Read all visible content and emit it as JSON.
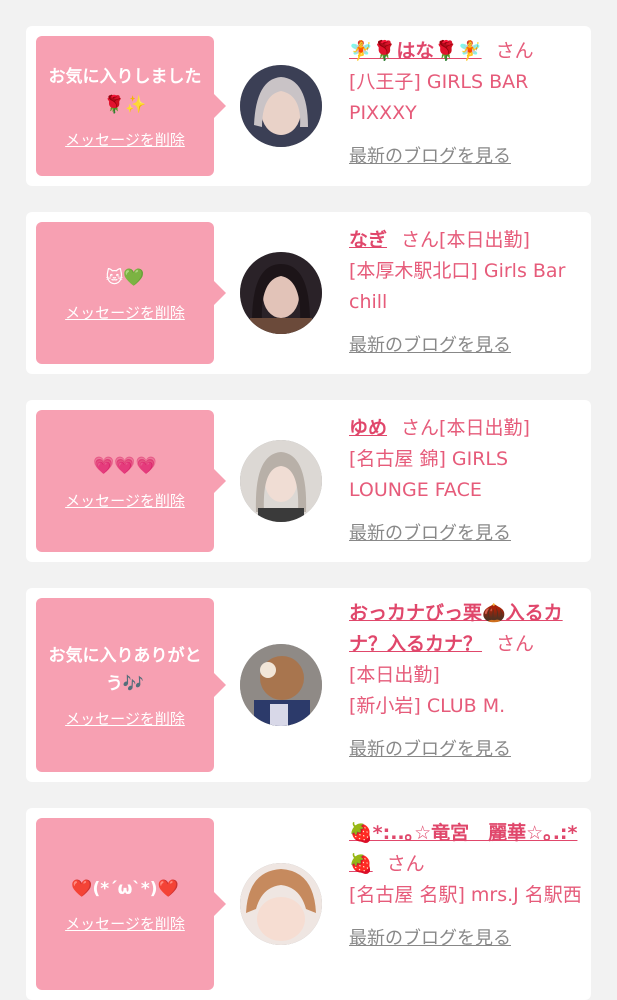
{
  "favorites": [
    {
      "message": "お気に入りしました🌹✨",
      "delete_label": "メッセージを削除",
      "name": "🧚🌹はな🌹🧚",
      "suffix": "さん",
      "status": "",
      "shop": "[八王子] GIRLS BAR PIXXXY",
      "blog_link": "最新のブログを見る"
    },
    {
      "message": "🐱💚",
      "delete_label": "メッセージを削除",
      "name": "なぎ",
      "suffix": "さん",
      "status": "[本日出勤]",
      "shop": "[本厚木駅北口] Girls Bar chill",
      "blog_link": "最新のブログを見る"
    },
    {
      "message": "💗💗💗",
      "delete_label": "メッセージを削除",
      "name": "ゆめ",
      "suffix": "さん",
      "status": "[本日出勤]",
      "shop": "[名古屋 錦] GIRLS LOUNGE FACE",
      "blog_link": "最新のブログを見る"
    },
    {
      "message": "お気に入りありがとう🎶",
      "delete_label": "メッセージを削除",
      "name": "おっカナびっ栗🌰入るカナ？入るカナ？",
      "suffix": "さん",
      "status": "[本日出勤]",
      "shop": "[新小岩] CLUB M.",
      "blog_link": "最新のブログを見る"
    },
    {
      "message": "❤️(*´ω`*)❤️",
      "delete_label": "メッセージを削除",
      "name": "🍓*:..｡☆竜宮　麗華☆｡.:*🍓",
      "suffix": "さん",
      "status": "",
      "shop": "[名古屋 名駅] mrs.J 名駅西",
      "blog_link": "最新のブログを見る"
    }
  ]
}
